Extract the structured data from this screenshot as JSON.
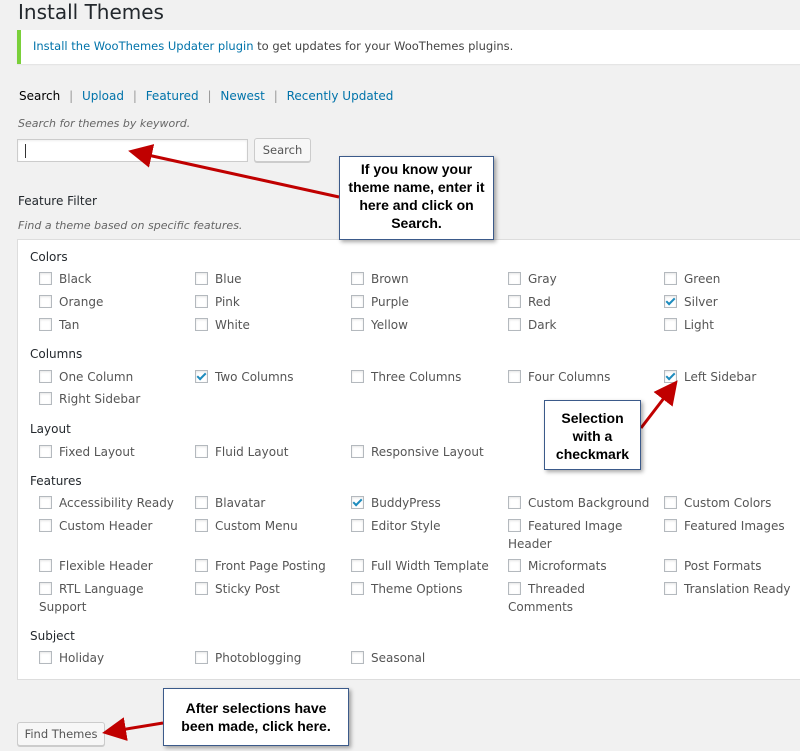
{
  "title": "Install Themes",
  "notice": {
    "link": "Install the WooThemes Updater plugin",
    "rest": " to get updates for your WooThemes plugins."
  },
  "subnav": {
    "current": "Search",
    "links": [
      "Upload",
      "Featured",
      "Newest",
      "Recently Updated"
    ],
    "separator": "|"
  },
  "search": {
    "hint": "Search for themes by keyword.",
    "value": "",
    "button": "Search"
  },
  "feature_filter": {
    "title": "Feature Filter",
    "hint": "Find a theme based on specific features.",
    "groups": [
      {
        "label": "Colors"
      },
      {
        "label": "Columns"
      },
      {
        "label": "Layout"
      },
      {
        "label": "Features"
      },
      {
        "label": "Subject"
      }
    ],
    "options": {
      "black": {
        "label": "Black",
        "checked": false
      },
      "blue": {
        "label": "Blue",
        "checked": false
      },
      "brown": {
        "label": "Brown",
        "checked": false
      },
      "gray": {
        "label": "Gray",
        "checked": false
      },
      "green": {
        "label": "Green",
        "checked": false
      },
      "orange": {
        "label": "Orange",
        "checked": false
      },
      "pink": {
        "label": "Pink",
        "checked": false
      },
      "purple": {
        "label": "Purple",
        "checked": false
      },
      "red": {
        "label": "Red",
        "checked": false
      },
      "silver": {
        "label": "Silver",
        "checked": true
      },
      "tan": {
        "label": "Tan",
        "checked": false
      },
      "white": {
        "label": "White",
        "checked": false
      },
      "yellow": {
        "label": "Yellow",
        "checked": false
      },
      "dark": {
        "label": "Dark",
        "checked": false
      },
      "light": {
        "label": "Light",
        "checked": false
      },
      "one_column": {
        "label": "One Column",
        "checked": false
      },
      "two_columns": {
        "label": "Two Columns",
        "checked": true
      },
      "three_columns": {
        "label": "Three Columns",
        "checked": false
      },
      "four_columns": {
        "label": "Four Columns",
        "checked": false
      },
      "left_sidebar": {
        "label": "Left Sidebar",
        "checked": true
      },
      "right_sidebar": {
        "label": "Right Sidebar",
        "checked": false
      },
      "fixed_layout": {
        "label": "Fixed Layout",
        "checked": false
      },
      "fluid_layout": {
        "label": "Fluid Layout",
        "checked": false
      },
      "responsive_layout": {
        "label": "Responsive Layout",
        "checked": false
      },
      "accessibility_ready": {
        "label": "Accessibility Ready",
        "checked": false
      },
      "blavatar": {
        "label": "Blavatar",
        "checked": false
      },
      "buddypress": {
        "label": "BuddyPress",
        "checked": true
      },
      "custom_background": {
        "label": "Custom Background",
        "checked": false
      },
      "custom_colors": {
        "label": "Custom Colors",
        "checked": false
      },
      "custom_header": {
        "label": "Custom Header",
        "checked": false
      },
      "custom_menu": {
        "label": "Custom Menu",
        "checked": false
      },
      "editor_style": {
        "label": "Editor Style",
        "checked": false
      },
      "featured_image_header": {
        "label": "Featured Image",
        "label2": "Header",
        "checked": false
      },
      "featured_images": {
        "label": "Featured Images",
        "checked": false
      },
      "flexible_header": {
        "label": "Flexible Header",
        "checked": false
      },
      "front_page_posting": {
        "label": "Front Page Posting",
        "checked": false
      },
      "full_width_template": {
        "label": "Full Width Template",
        "checked": false
      },
      "microformats": {
        "label": "Microformats",
        "checked": false
      },
      "post_formats": {
        "label": "Post Formats",
        "checked": false
      },
      "rtl_language_support": {
        "label": "RTL Language",
        "label2": "Support",
        "checked": false
      },
      "sticky_post": {
        "label": "Sticky Post",
        "checked": false
      },
      "theme_options": {
        "label": "Theme Options",
        "checked": false
      },
      "threaded_comments": {
        "label": "Threaded",
        "label2": "Comments",
        "checked": false
      },
      "translation_ready": {
        "label": "Translation Ready",
        "checked": false
      },
      "holiday": {
        "label": "Holiday",
        "checked": false
      },
      "photoblogging": {
        "label": "Photoblogging",
        "checked": false
      },
      "seasonal": {
        "label": "Seasonal",
        "checked": false
      }
    }
  },
  "find_button": "Find Themes",
  "callouts": {
    "search": "If you know your theme name, enter it here and click on Search.",
    "check": "Selection with a checkmark",
    "find": "After selections have been made, click here."
  },
  "colors": {
    "accent": "#0073aa",
    "notice_border": "#7ad03a",
    "arrow": "#c00000",
    "checkmark": "#1e8cbe"
  }
}
